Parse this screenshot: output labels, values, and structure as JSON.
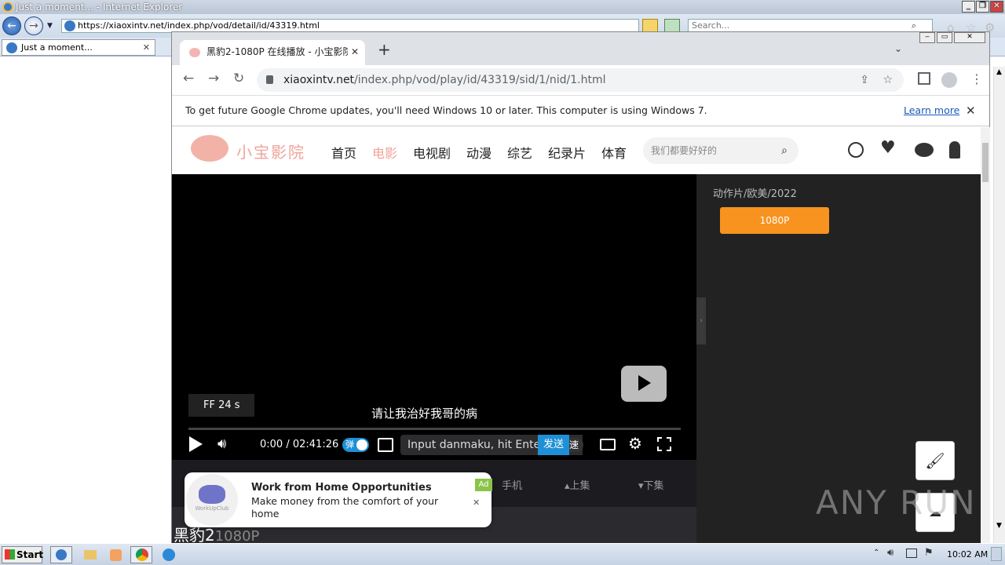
{
  "ie": {
    "title": "Just a moment... - Internet Explorer",
    "address": "https://xiaoxintv.net/index.php/vod/detail/id/43319.html",
    "search_placeholder": "Search...",
    "tab_title": "Just a moment..."
  },
  "chrome": {
    "tab_title": "黑豹2-1080P 在线播放 - 小宝影院 -",
    "url_host": "xiaoxintv.net",
    "url_path": "/index.php/vod/play/id/43319/sid/1/nid/1.html",
    "infobar_text": "To get future Google Chrome updates, you'll need Windows 10 or later. This computer is using Windows 7.",
    "infobar_link": "Learn more"
  },
  "site": {
    "logo_text": "小宝影院",
    "nav": [
      "首页",
      "电影",
      "电视剧",
      "动漫",
      "综艺",
      "纪录片",
      "体育"
    ],
    "active_nav": "电影",
    "search_placeholder": "我们都要好好的",
    "accent_color": "#f7931e",
    "category": "动作片/欧美/2022",
    "source_button": "1080P",
    "below_links": {
      "mobile": "手机",
      "prev": "▴上集",
      "next": "▾下集"
    },
    "video_title": "黑豹2",
    "video_quality": "1080P"
  },
  "player": {
    "ff_toast": "FF 24 s",
    "subtitle": "请让我治好我哥的病",
    "time_current": "0:00",
    "time_total": "02:41:26",
    "danmaku_toggle": "弹",
    "danmaku_placeholder": "Input danmaku, hit Enter",
    "send_button": "发送",
    "speed_label": "速",
    "progress": 0.0
  },
  "ad": {
    "badge": "Ad",
    "logo_text": "WorkUpClub",
    "title": "Work from Home Opportunities",
    "body": "Make money from the comfort of your home"
  },
  "watermark": "ANY RUN",
  "taskbar": {
    "start": "Start",
    "clock": "10:02 AM"
  }
}
